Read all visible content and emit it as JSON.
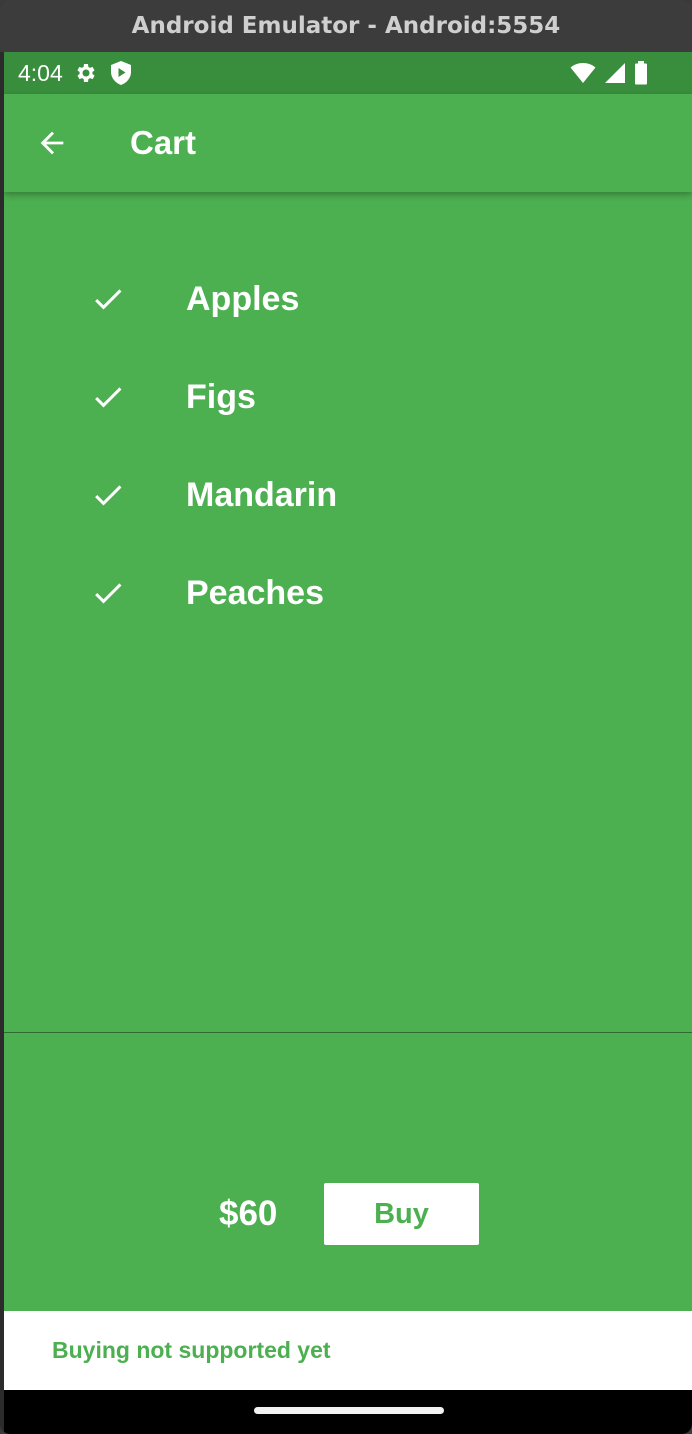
{
  "window": {
    "title": "Android Emulator - Android:5554"
  },
  "status_bar": {
    "time": "4:04",
    "left_icons": [
      "settings-gear-icon",
      "play-protect-icon"
    ],
    "right_icons": [
      "wifi-icon",
      "cellular-signal-icon",
      "battery-icon"
    ]
  },
  "app_bar": {
    "title": "Cart",
    "back_icon": "arrow-back-icon"
  },
  "cart": {
    "items": [
      {
        "label": "Apples",
        "icon": "check-icon"
      },
      {
        "label": "Figs",
        "icon": "check-icon"
      },
      {
        "label": "Mandarin",
        "icon": "check-icon"
      },
      {
        "label": "Peaches",
        "icon": "check-icon"
      }
    ]
  },
  "total": {
    "price": "$60",
    "buy_label": "Buy"
  },
  "snackbar": {
    "message": "Buying not supported yet"
  },
  "colors": {
    "primary": "#4caf50",
    "status_bar": "#388e3c",
    "on_primary": "#ffffff",
    "snackbar_background": "#ffffff",
    "snackbar_text": "#4caf50"
  }
}
